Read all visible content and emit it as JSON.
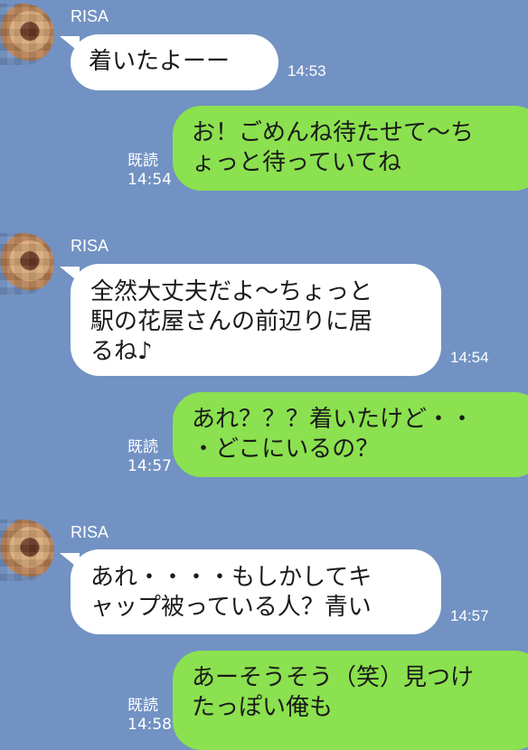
{
  "contact": {
    "name": "RISA"
  },
  "messages": [
    {
      "type": "in",
      "text": "着いたよーー",
      "time": "14:53"
    },
    {
      "type": "out",
      "text": "お！ごめんね待たせて〜ち\nょっと待っていてね",
      "read": "既読",
      "time": "14:54"
    },
    {
      "type": "in",
      "text": "全然大丈夫だよ〜ちょっと\n駅の花屋さんの前辺りに居\nるね♪",
      "time": "14:54"
    },
    {
      "type": "out",
      "text": "あれ？？？着いたけど・・\n・どこにいるの？",
      "read": "既読",
      "time": "14:57"
    },
    {
      "type": "in",
      "text": "あれ・・・・もしかしてキ\nャップ被っている人？青い",
      "time": "14:57"
    },
    {
      "type": "out",
      "text": "あーそうそう（笑）見つけ\nたっぽい俺も",
      "read": "既読",
      "time": "14:58"
    }
  ],
  "colors": {
    "background": "#7292c3",
    "incoming": "#ffffff",
    "outgoing": "#8be14f"
  },
  "icons": {
    "avatar": "blurred-profile-photo"
  }
}
